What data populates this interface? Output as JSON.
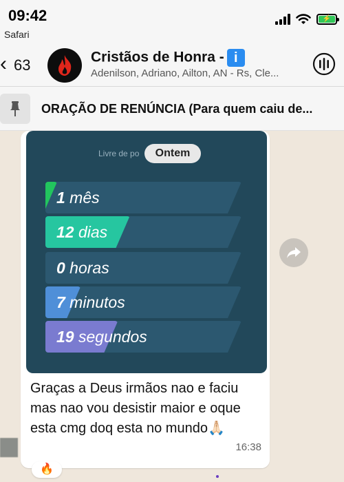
{
  "status_bar": {
    "time": "09:42",
    "back_app": "Safari",
    "battery_color": "#32c759"
  },
  "chat_header": {
    "unread_count": "63",
    "group_name": "Cristãos de Honra -",
    "group_emoji": "ℹ️",
    "members": "Adenilson, Adriano, Ailton, AN - Rs, Cle...",
    "avatar_icon": "flame-icon",
    "call_icon": "voice-call-icon"
  },
  "pinned": {
    "icon": "pin-icon",
    "text": "ORAÇÃO DE RENÚNCIA (Para quem caiu de..."
  },
  "message": {
    "media": {
      "caption": "Livre de po",
      "date_pill": "Ontem",
      "stats": [
        {
          "number": "1",
          "unit": "mês",
          "fill": 0.06,
          "color": "#22c55e"
        },
        {
          "number": "12",
          "unit": "dias",
          "fill": 0.43,
          "color": "#26c6a0"
        },
        {
          "number": "0",
          "unit": "horas",
          "fill": 0.0,
          "color": "#2c5870"
        },
        {
          "number": "7",
          "unit": "minutos",
          "fill": 0.18,
          "color": "#4f8fd8"
        },
        {
          "number": "19",
          "unit": "segundos",
          "fill": 0.37,
          "color": "#7a7bd0"
        }
      ],
      "card_color": "#22485a"
    },
    "text": "Graças a Deus irmãos nao e faciu mas nao vou desistir maior e oque esta cmg doq esta no mundo🙏🏻",
    "time": "16:38",
    "reaction": "🔥"
  }
}
